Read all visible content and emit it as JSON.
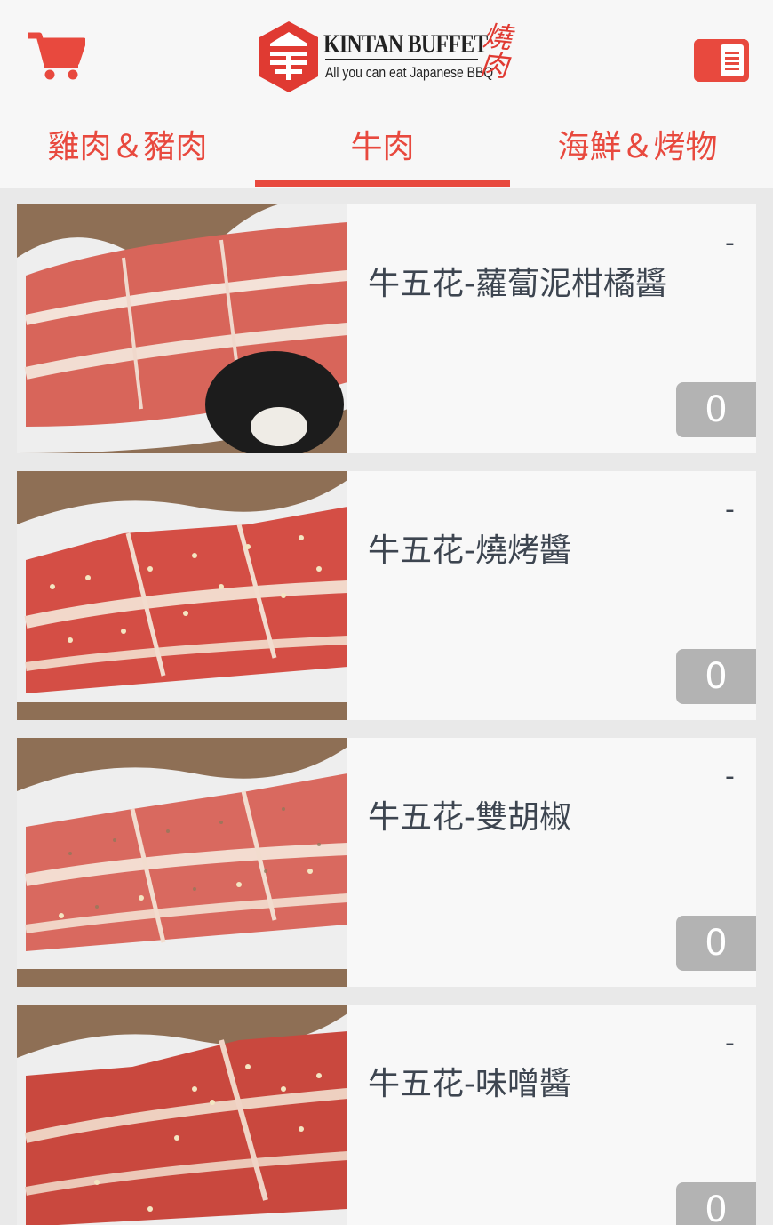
{
  "header": {
    "cart_icon": "shopping-cart-icon",
    "menu_icon": "list-menu-icon",
    "logo": {
      "title": "KINTAN BUFFET",
      "subtitle": "All you can eat Japanese BBQ",
      "kanji": "燒肉"
    }
  },
  "tabs": [
    {
      "label": "雞肉＆豬肉",
      "active": false
    },
    {
      "label": "牛肉",
      "active": true
    },
    {
      "label": "海鮮＆烤物",
      "active": false
    }
  ],
  "colors": {
    "accent": "#e8493e",
    "text": "#3d4550",
    "qty_badge": "#b3b3b3",
    "card_bg": "#f8f8f8",
    "page_bg": "#e9e9e9"
  },
  "items": [
    {
      "name": "牛五花-蘿蔔泥柑橘醬",
      "minus": "-",
      "qty": "0"
    },
    {
      "name": "牛五花-燒烤醬",
      "minus": "-",
      "qty": "0"
    },
    {
      "name": "牛五花-雙胡椒",
      "minus": "-",
      "qty": "0"
    },
    {
      "name": "牛五花-味噌醬",
      "minus": "-",
      "qty": "0"
    }
  ]
}
